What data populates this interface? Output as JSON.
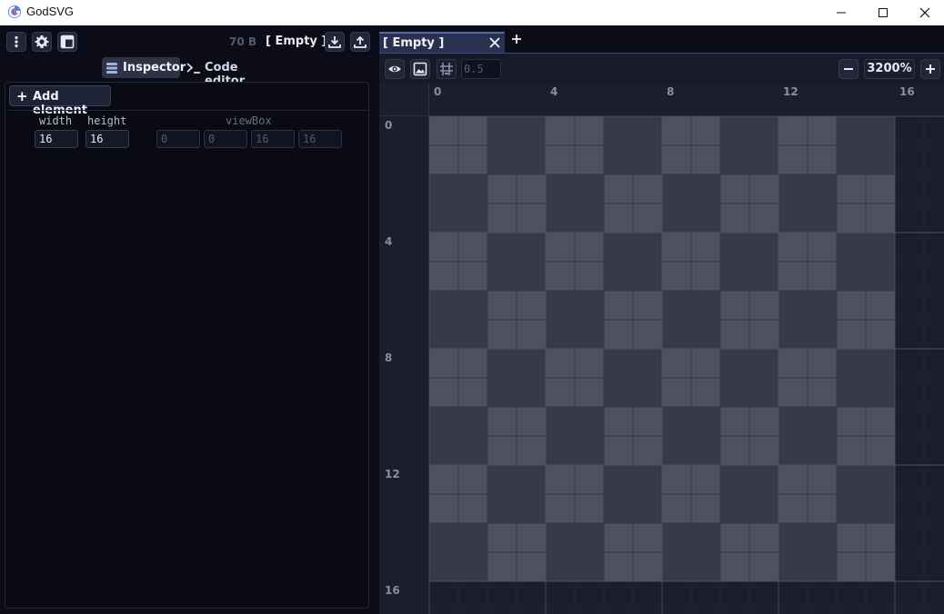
{
  "window": {
    "title": "GodSVG",
    "minimize_icon": "minimize-icon",
    "maximize_icon": "maximize-icon",
    "close_icon": "close-icon"
  },
  "left_panel": {
    "file_size": "70 B",
    "file_name": "[ Empty ]",
    "tabs": [
      {
        "label": "Inspector",
        "icon": "list-icon",
        "active": true
      },
      {
        "label": "Code editor",
        "icon": "terminal-icon",
        "active": false
      }
    ],
    "add_element_label": "Add element",
    "svg_attributes": {
      "width_label": "width",
      "height_label": "height",
      "viewbox_label": "viewBox",
      "width_value": "16",
      "height_value": "16",
      "viewbox_values": [
        "0",
        "0",
        "16",
        "16"
      ]
    }
  },
  "right_panel": {
    "doc_tab_label": "[ Empty ]",
    "snap_value": "0.5",
    "zoom_level": "3200%",
    "ruler_x_labels": [
      "0",
      "4",
      "8",
      "12",
      "16"
    ],
    "ruler_y_labels": [
      "0",
      "4",
      "8",
      "12",
      "16"
    ]
  },
  "colors": {
    "accent": "#4a6aa8",
    "checker_light": "#4f5160",
    "checker_dark": "#383a48",
    "canvas_bg": "#1b1e2d"
  }
}
